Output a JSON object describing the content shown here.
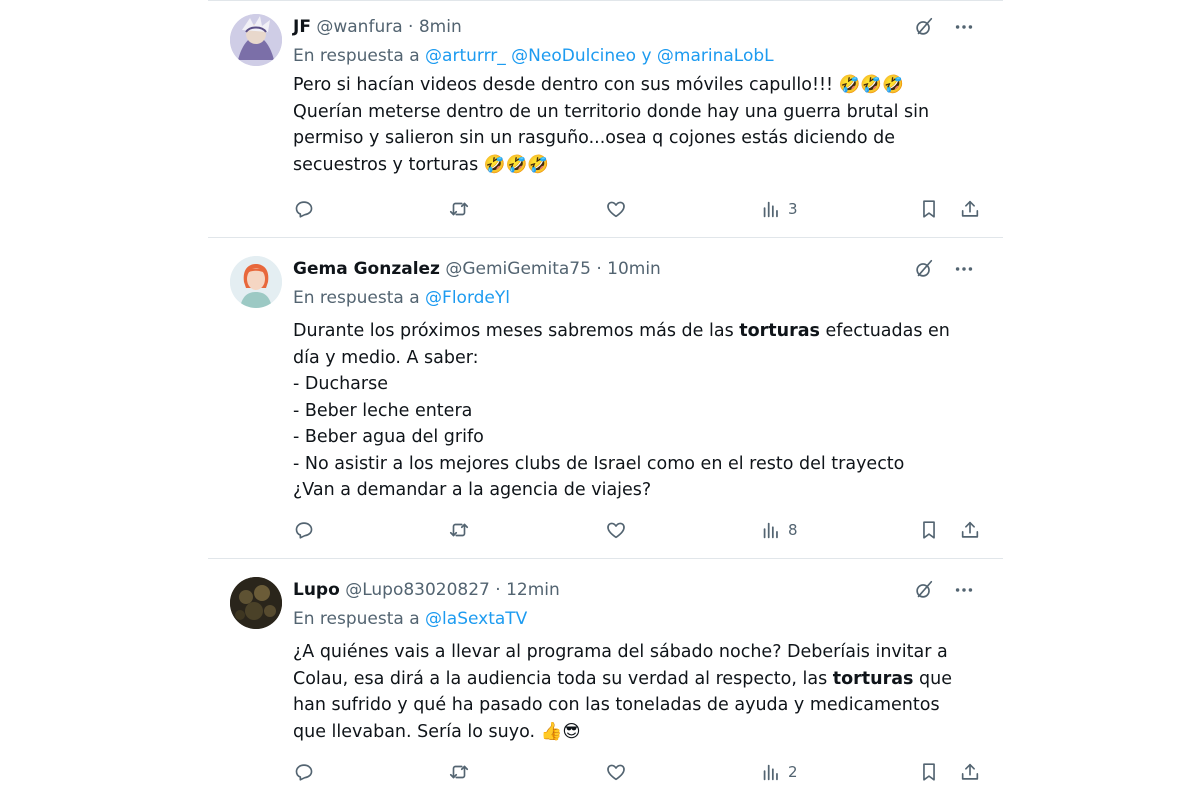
{
  "tweets": [
    {
      "name": "JF",
      "handle": "@wanfura",
      "sep": "·",
      "time": "8min",
      "reply_prefix": "En respuesta a",
      "mention_1": "@arturrr_",
      "mention_2": "@NeoDulcineo",
      "reply_conj": "y",
      "mention_3": "@marinaLobL",
      "lines": [
        "Pero si hacían videos desde dentro con sus móviles capullo!!! 🤣🤣🤣",
        "Querían meterse dentro de un territorio donde hay una guerra brutal sin",
        "permiso y salieron sin un rasguño...osea q cojones estás diciendo de",
        "secuestros y torturas 🤣🤣🤣"
      ],
      "views": "3"
    },
    {
      "name": "Gema Gonzalez",
      "handle": "@GemiGemita75",
      "sep": "·",
      "time": "10min",
      "reply_prefix": "En respuesta a",
      "mention_1": "@FlordeYl",
      "line_1_pre": "Durante los próximos meses sabremos más de las ",
      "line_1_bold": "torturas",
      "line_1_post": " efectuadas en",
      "lines": [
        "día y medio. A saber:",
        "- Ducharse",
        "- Beber leche entera",
        "- Beber agua del grifo",
        "- No asistir a los mejores clubs de Israel como en el resto del trayecto",
        "¿Van a demandar a la agencia de viajes?"
      ],
      "views": "8"
    },
    {
      "name": "Lupo",
      "handle": "@Lupo83020827",
      "sep": "·",
      "time": "12min",
      "reply_prefix": "En respuesta a",
      "mention_1": "@laSextaTV",
      "line_1": "¿A quiénes vais a llevar al programa del sábado noche? Deberíais invitar a",
      "line_2_pre": "Colau, esa dirá a la audiencia toda su verdad al respecto, las ",
      "line_2_bold": "torturas",
      "line_2_post": " que",
      "line_3": "han sufrido y qué ha pasado con las toneladas de ayuda y medicamentos",
      "line_4": "que llevaban. Sería lo suyo. 👍😎",
      "views": "2"
    }
  ],
  "colors": {
    "text": "#0f1419",
    "secondary": "#536471",
    "link": "#1d9bf0",
    "divider": "#e1e6ea"
  },
  "icons": [
    "grok-icon",
    "more-icon",
    "reply-icon",
    "retweet-icon",
    "like-icon",
    "views-icon",
    "bookmark-icon",
    "share-icon"
  ]
}
